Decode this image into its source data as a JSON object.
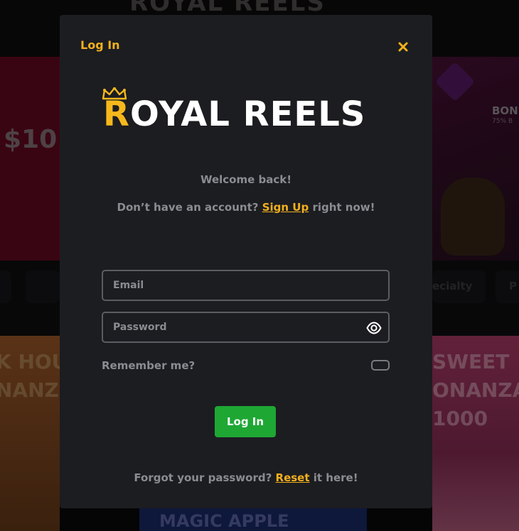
{
  "background": {
    "logo_text": "ROYAL REELS",
    "banner_left_text": "$10 C",
    "banner_right_title": "BON",
    "banner_right_sub": "75% B",
    "category_chip_text": "ecialty",
    "category_chip_text_2": "P",
    "tile_left_text": "K HOU\nNANZ",
    "tile_right_text": "SWEET\nONANZA\n1000",
    "tile_bottom_text": "MAGIC APPLE"
  },
  "modal": {
    "title": "Log In",
    "close_icon": "close-icon",
    "brand": {
      "first_letter": "R",
      "rest": "OYAL REELS",
      "crown_icon": "crown-icon"
    },
    "welcome": "Welcome back!",
    "signup_prefix": "Don’t have an account?",
    "signup_link": "Sign Up",
    "signup_suffix": "right now!",
    "email_placeholder": "Email",
    "email_value": "",
    "password_placeholder": "Password",
    "password_value": "",
    "password_toggle_icon": "eye-icon",
    "remember_label": "Remember me?",
    "remember_checked": false,
    "login_button": "Log In",
    "forgot_prefix": "Forgot your password?",
    "forgot_link": "Reset",
    "forgot_suffix": "it here!"
  },
  "colors": {
    "accent": "#f2b01e",
    "login_button": "#1fa734",
    "modal_bg": "#1c1d21",
    "muted_text": "#8b8c92"
  }
}
